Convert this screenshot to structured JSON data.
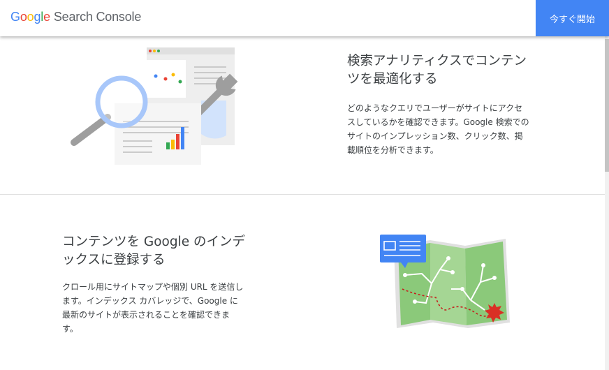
{
  "header": {
    "logo_google": "Google",
    "logo_product": "Search Console",
    "cta_label": "今すぐ開始"
  },
  "sections": [
    {
      "title": "検索アナリティクスでコンテンツを最適化する",
      "title_line1": "検索アナリティクスでコンテン",
      "title_line2": "ツを最適化する",
      "body_line1": "どのようなクエリでユーザーがサイトにアクセ",
      "body_line2": "スしているかを確認できます。Google 検索での",
      "body_line3": "サイトのインプレッション数、クリック数、掲",
      "body_line4": "載順位を分析できます。"
    },
    {
      "title_line1": "コンテンツを Google のインデ",
      "title_line2": "ックスに登録する",
      "body_line1": "クロール用にサイトマップや個別 URL を送信し",
      "body_line2": "ます。インデックス カバレッジで、Google に",
      "body_line3": "最新のサイトが表示されることを確認できま",
      "body_line4": "す。"
    }
  ],
  "colors": {
    "blue": "#4285f4",
    "red": "#ea4335",
    "yellow": "#fbbc05",
    "green": "#34a853",
    "text": "#3c4043"
  },
  "icons": {
    "illustration_1": "analytics-magnifier-wrench-illustration",
    "illustration_2": "map-index-illustration"
  }
}
